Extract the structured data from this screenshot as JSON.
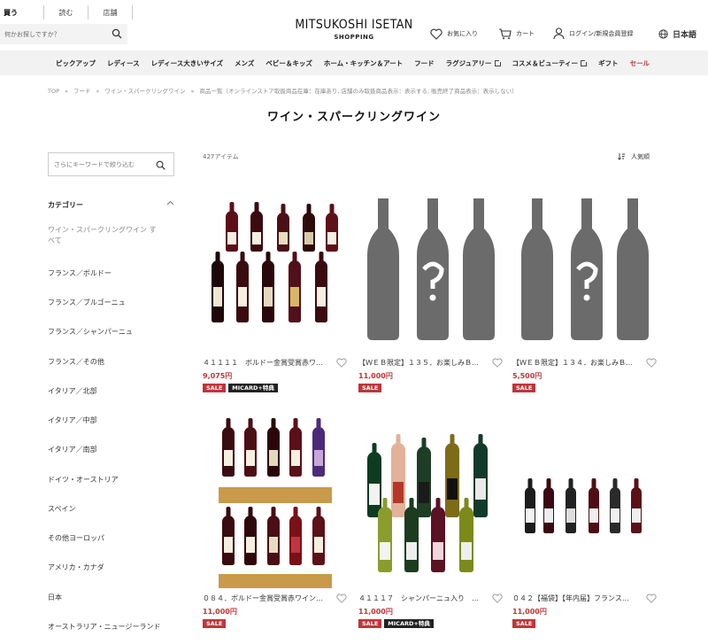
{
  "header": {
    "modes": [
      "買う",
      "読む",
      "店舗"
    ],
    "search_placeholder": "何かお探しですか？",
    "logo_main": "MITSUKOSHI ISETAN",
    "logo_sub": "SHOPPING",
    "favorites": "お気に入り",
    "cart": "カート",
    "login": "ログイン/新規会員登録",
    "language": "日本語"
  },
  "nav": {
    "items": [
      "ピックアップ",
      "レディース",
      "レディース大きいサイズ",
      "メンズ",
      "ベビー＆キッズ",
      "ホーム・キッチン＆アート",
      "フード",
      "ラグジュアリー",
      "コスメ＆ビューティー",
      "ギフト",
      "セール"
    ]
  },
  "breadcrumb": [
    "TOP",
    "»",
    "フード",
    "»",
    "ワイン・スパークリングワイン",
    "»",
    "商品一覧（オンラインストア取扱商品在庫：在庫あり, 店舗のみ取扱商品表示：表示する, 販売終了商品表示：表示しない）"
  ],
  "page_title": "ワイン・スパークリングワイン",
  "sidebar": {
    "search_placeholder": "さらにキーワードで絞り込む",
    "category_heading": "カテゴリー",
    "current_category": "ワイン・スパークリングワイン すべて",
    "categories": [
      "フランス／ボルドー",
      "フランス／ブルゴーニュ",
      "フランス／シャンパーニュ",
      "フランス／その他",
      "イタリア／北部",
      "イタリア／中部",
      "イタリア／南部",
      "ドイツ・オーストリア",
      "スペイン",
      "その他ヨーロッパ",
      "アメリカ・カナダ",
      "日本",
      "オーストラリア・ニュージーランド"
    ]
  },
  "results": {
    "count": "427アイテム",
    "sort": "人気順"
  },
  "products": [
    {
      "name": "４１１１１　ボルドー金賞受賞赤ワ…",
      "price": "9,075円",
      "badges": [
        "SALE",
        "MICARD+特典"
      ]
    },
    {
      "name": "【ＷＥＢ限定】１３５．お楽しみＢ…",
      "price": "11,000円",
      "badges": [
        "SALE"
      ]
    },
    {
      "name": "【ＷＥＢ限定】１３４．お楽しみＢ…",
      "price": "5,500円",
      "badges": [
        "SALE"
      ]
    },
    {
      "name": "０８４．ボルドー金賞受賞赤ワイン…",
      "price": "11,000円",
      "badges": [
        "SALE"
      ]
    },
    {
      "name": "４１１１７　シャンパーニュ入り　…",
      "price": "11,000円",
      "badges": [
        "SALE",
        "MICARD+特典"
      ]
    },
    {
      "name": "０４２【福袋】【年内届】フランス…",
      "price": "11,000円",
      "badges": [
        "SALE"
      ]
    }
  ],
  "colors": {
    "sale": "#c0353a",
    "nav_bg": "#f2f2f2",
    "placeholder_bottle": "#6b6b6b"
  },
  "icons": [
    "search-icon",
    "heart-icon",
    "cart-icon",
    "user-icon",
    "globe-icon",
    "chevron-up-icon",
    "external-link-icon",
    "sort-icon"
  ]
}
